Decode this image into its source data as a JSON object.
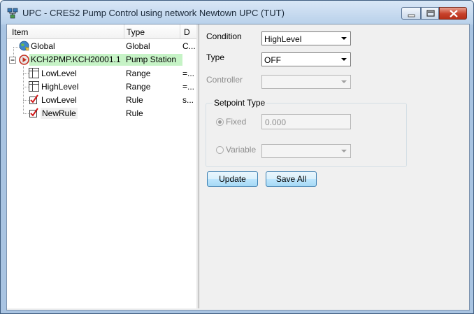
{
  "window": {
    "title": "UPC - CRES2 Pump Control  using network Newtown UPC (TUT)"
  },
  "tree": {
    "columns": [
      "Item",
      "Type",
      "D"
    ],
    "rows": [
      {
        "item": "Global",
        "type": "Global",
        "detail": "C...",
        "icon": "globe-icon"
      },
      {
        "item": "KCH2PMP.KCH20001.1",
        "type": "Pump Station",
        "detail": "",
        "icon": "pump-station-icon",
        "selected": true
      },
      {
        "item": "LowLevel",
        "type": "Range",
        "detail": "=...",
        "icon": "range-table-icon"
      },
      {
        "item": "HighLevel",
        "type": "Range",
        "detail": "=...",
        "icon": "range-table-icon"
      },
      {
        "item": "LowLevel",
        "type": "Rule",
        "detail": "s...",
        "icon": "rule-check-icon"
      },
      {
        "item": "NewRule",
        "type": "Rule",
        "detail": "",
        "icon": "rule-check-icon"
      }
    ]
  },
  "form": {
    "condition_label": "Condition",
    "condition_value": "HighLevel",
    "type_label": "Type",
    "type_value": "OFF",
    "controller_label": "Controller",
    "controller_value": "",
    "setpoint_group": "Setpoint Type",
    "fixed_label": "Fixed",
    "fixed_value": "0.000",
    "variable_label": "Variable",
    "variable_value": "",
    "update_button": "Update",
    "save_all_button": "Save All"
  },
  "colors": {
    "selected_row": "#c6f3c6",
    "window_frame": "#a9c4e2",
    "close_button": "#c7412b"
  }
}
